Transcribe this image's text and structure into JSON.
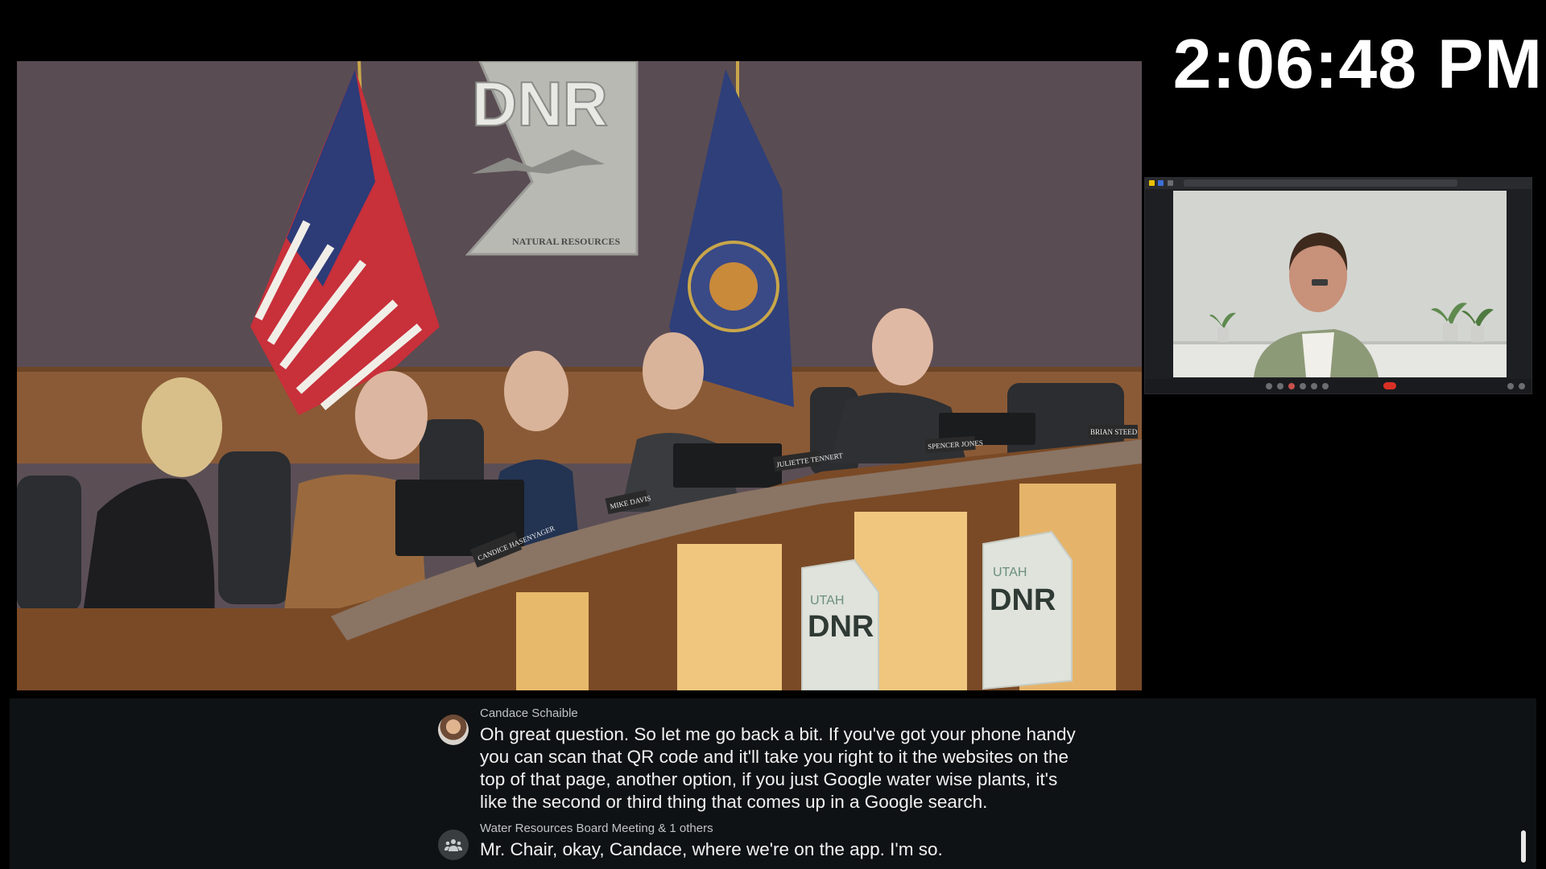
{
  "clock": {
    "time": "2:06:48 PM"
  },
  "room": {
    "wall_sign": {
      "title": "DNR",
      "subtitle": "NATURAL RESOURCES"
    },
    "desk_signs": [
      {
        "text": "UTAH"
      },
      {
        "text": "DNR"
      }
    ],
    "nameplates": [
      "CANDICE HASENYAGER",
      "MIKE DAVIS",
      "JULIETTE TENNERT",
      "SPENCER JONES",
      "BRIAN STEED"
    ]
  },
  "remote_participant": {
    "name": "Candace Schaible"
  },
  "captions": {
    "entries": [
      {
        "speaker": "Candace Schaible",
        "avatar": "speaker-avatar-photo",
        "text": "Oh great question. So let me go back a bit. If you've got your phone handy\nyou can scan that QR code and it'll take you right to it the websites on the\ntop of that page, another option, if you just Google water wise plants, it's\nlike the second or third thing that comes up in a Google search."
      },
      {
        "speaker": "Water Resources Board Meeting & 1 others",
        "avatar": "group-icon",
        "text": "Mr. Chair, okay, Candace, where we're on the app. I'm so."
      }
    ]
  },
  "colors": {
    "background": "#000000",
    "caption_bar": "#0f1214",
    "caption_text": "#f2f2f2",
    "speaker_text": "#bfc3c6",
    "end_call": "#d93025"
  }
}
